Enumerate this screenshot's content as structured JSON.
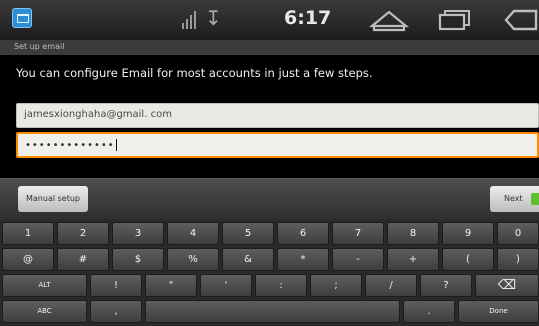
{
  "status_bar": {
    "time": "6:17",
    "icons": [
      "app-icon",
      "signal-icon",
      "usb-icon",
      "home-icon",
      "recent-apps-icon",
      "back-icon"
    ]
  },
  "screen": {
    "title": "Set up email",
    "instructions": "You can configure Email for most accounts in just a few steps.",
    "email_value": "jamesxionghaha@gmail. com",
    "password_value": "•••••••••••••"
  },
  "actions": {
    "manual_setup_label": "Manual setup",
    "next_label": "Next"
  },
  "keyboard": {
    "row1": [
      "1",
      "2",
      "3",
      "4",
      "5",
      "6",
      "7",
      "8",
      "9",
      "0"
    ],
    "row2": [
      "@",
      "#",
      "$",
      "%",
      "&",
      "*",
      "-",
      "+",
      "(",
      ")"
    ],
    "row3": [
      "ALT",
      "!",
      "\"",
      "'",
      ":",
      ";",
      "/",
      "?",
      "⌫"
    ],
    "row4": [
      "ABC",
      ",",
      "",
      ".",
      "Done"
    ]
  },
  "colors": {
    "focus_border": "#ff8a00",
    "next_arrow": "#5fbf2d"
  }
}
